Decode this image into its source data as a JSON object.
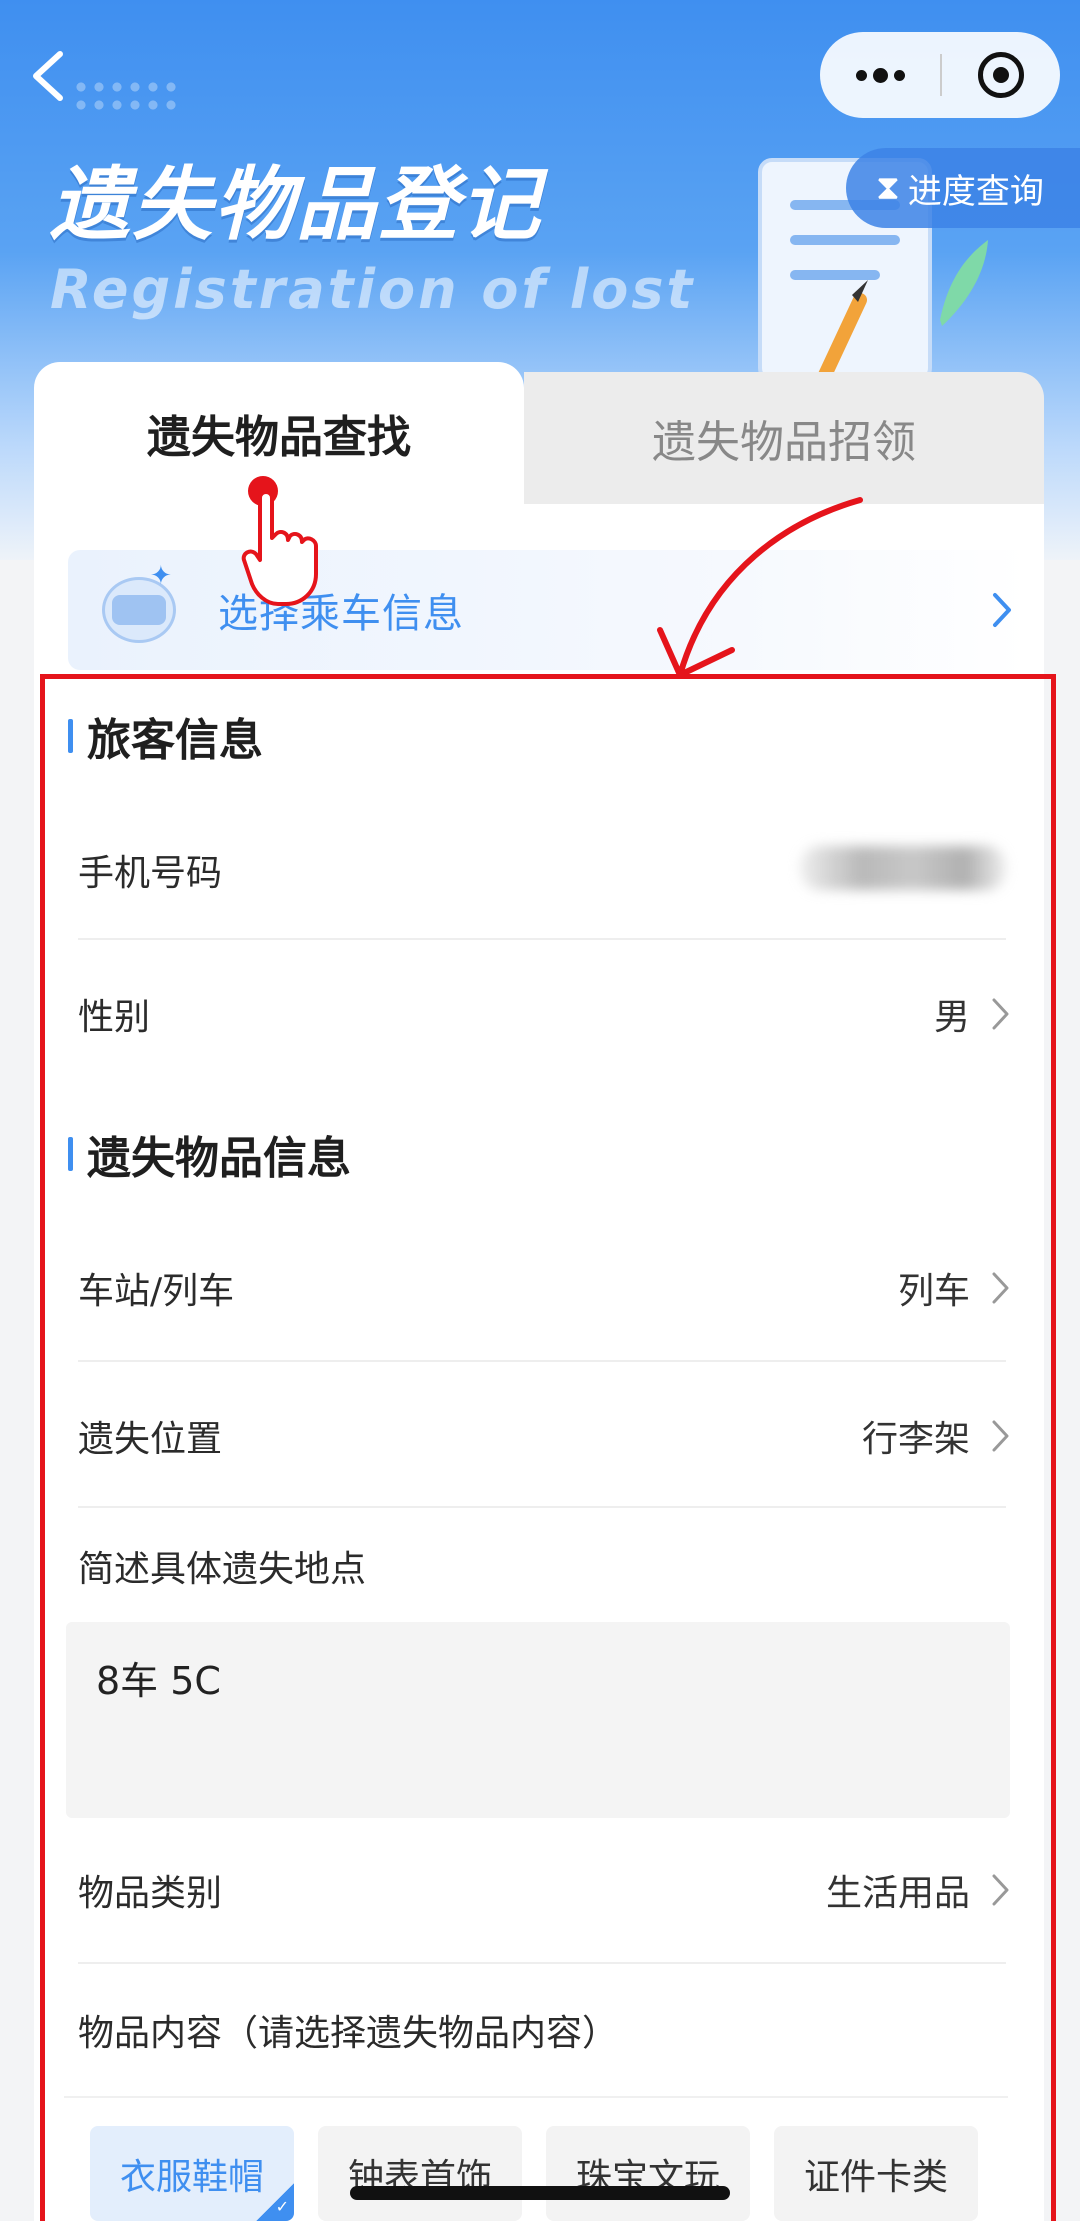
{
  "header": {
    "title": "遗失物品登记",
    "subtitle_en": "Registration of lost",
    "progress_button": "进度查询",
    "progress_icon": "hourglass-icon"
  },
  "tabs": {
    "active": "遗失物品查找",
    "inactive": "遗失物品招领"
  },
  "trip_selector": {
    "label": "选择乘车信息",
    "icon": "passenger-mask-icon"
  },
  "passenger_section": {
    "title": "旅客信息",
    "phone_label": "手机号码",
    "gender_label": "性别",
    "gender_value": "男"
  },
  "item_section": {
    "title": "遗失物品信息",
    "station_label": "车站/列车",
    "station_value": "列车",
    "position_label": "遗失位置",
    "position_value": "行李架",
    "detail_label": "简述具体遗失地点",
    "detail_value": "8车 5C",
    "category_label": "物品类别",
    "category_value": "生活用品",
    "content_label": "物品内容（请选择遗失物品内容）",
    "content_options": [
      "衣服鞋帽",
      "钟表首饰",
      "珠宝文玩",
      "证件卡类"
    ],
    "selected_option": "衣服鞋帽"
  },
  "colors": {
    "accent": "#3f8ff0",
    "annotation_red": "#e5141b"
  }
}
